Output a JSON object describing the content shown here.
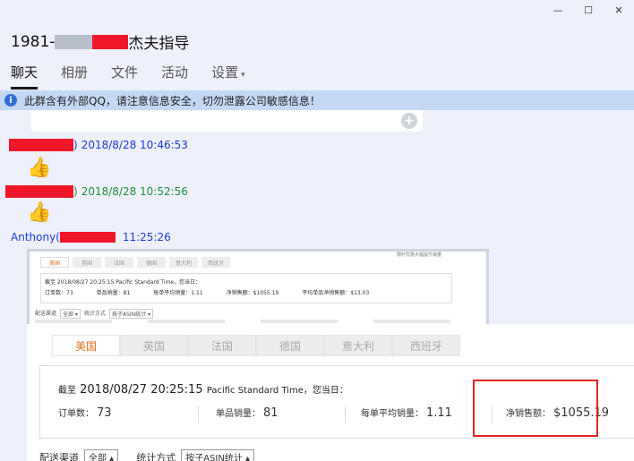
{
  "window": {
    "minimize": "—",
    "maximize": "☐",
    "close": "✕"
  },
  "header": {
    "title_prefix": "1981-",
    "title_suffix": "杰夫指导"
  },
  "tabs": [
    {
      "label": "聊天",
      "active": true
    },
    {
      "label": "相册"
    },
    {
      "label": "文件"
    },
    {
      "label": "活动"
    },
    {
      "label": "设置"
    }
  ],
  "banner": {
    "text": "此群含有外部QQ，请注意信息安全，切勿泄露公司敏感信息！"
  },
  "messages": [
    {
      "sender_suffix": ")",
      "time": "2018/8/28 10:46:53",
      "content": "👍"
    },
    {
      "sender_suffix": ")",
      "time": "2018/8/28 10:52:56",
      "content": "👍"
    },
    {
      "sender_prefix": "Anthony(",
      "time": "11:25:26"
    }
  ],
  "mini_screenshot": {
    "tabs": [
      "美国",
      "英国",
      "法国",
      "德国",
      "意大利",
      "西班牙"
    ],
    "note": "限时优惠大幅提升销量",
    "date_line": "截至 2018/08/27 20:25:15 Pacific Standard Time，您当日：",
    "stats": [
      "订单数：73",
      "单品销量：81",
      "每单平均销量：1.11",
      "净销售额：$1055.19",
      "平均单品净销售额：$13.03"
    ],
    "filter_label1": "配送渠道",
    "filter_sel1": "全部 ▾",
    "filter_label2": "统计方式",
    "filter_sel2": "按子ASIN统计 ▾"
  },
  "zoomed_screenshot": {
    "tabs": [
      "美国",
      "英国",
      "法国",
      "德国",
      "意大利",
      "西班牙"
    ],
    "date_prefix": "截至",
    "date_value": "2018/08/27 20:25:15",
    "date_tz": "Pacific Standard Time",
    "date_suffix": "，您当日：",
    "stats": [
      {
        "label": "订单数：",
        "value": "73"
      },
      {
        "label": "单品销量：",
        "value": "81"
      },
      {
        "label": "每单平均销量：",
        "value": "1.11"
      },
      {
        "label": "净销售额：",
        "value": "$1055.19"
      }
    ],
    "filter_label1": "配送渠道",
    "filter_sel1": "全部 ▴",
    "filter_label2": "统计方式",
    "filter_sel2": "按子ASIN统计 ▴"
  },
  "colors": {
    "accent_orange": "#e2701b",
    "highlight_red": "#e02626",
    "sender_blue": "#1a38d4",
    "sender_green": "#1f8d3a"
  }
}
